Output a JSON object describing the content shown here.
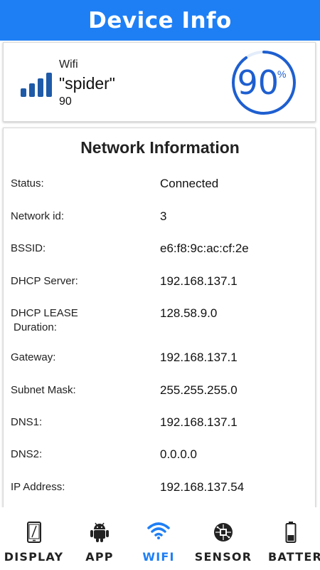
{
  "header": {
    "title": "Device Info"
  },
  "wifi_summary": {
    "type_label": "Wifi",
    "ssid": "\"spider\"",
    "signal_level": "90",
    "percent_value": "90",
    "percent_sign": "%",
    "gauge_fraction": 0.9
  },
  "network_info": {
    "heading": "Network Information",
    "rows": [
      {
        "label": "Status:",
        "value": "Connected"
      },
      {
        "label": "Network id:",
        "value": "3"
      },
      {
        "label": "BSSID:",
        "value": "e6:f8:9c:ac:cf:2e"
      },
      {
        "label": "DHCP Server:",
        "value": "192.168.137.1"
      },
      {
        "label": "DHCP LEASE",
        "label2": "Duration:",
        "value": "128.58.9.0"
      },
      {
        "label": "Gateway:",
        "value": "192.168.137.1"
      },
      {
        "label": "Subnet Mask:",
        "value": "255.255.255.0"
      },
      {
        "label": "DNS1:",
        "value": "192.168.137.1"
      },
      {
        "label": "DNS2:",
        "value": "0.0.0.0"
      },
      {
        "label": "IP Address:",
        "value": "192.168.137.54"
      }
    ]
  },
  "bottom_nav": {
    "items": [
      {
        "label": "DISPLAY",
        "icon": "phone-display-icon"
      },
      {
        "label": "APP",
        "icon": "android-icon"
      },
      {
        "label": "WIFI",
        "icon": "wifi-icon"
      },
      {
        "label": "SENSOR",
        "icon": "sensor-chip-icon"
      },
      {
        "label": "BATTERY",
        "icon": "battery-icon"
      }
    ],
    "active": "WIFI"
  },
  "colors": {
    "accent": "#1e7ff5",
    "gauge": "#1e5fd0",
    "signal_bars": "#1e5aa8"
  }
}
